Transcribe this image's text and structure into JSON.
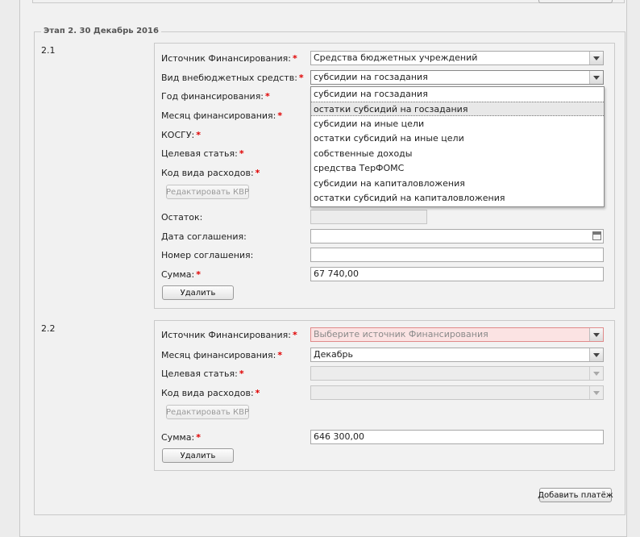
{
  "stage_title": "Этап 2. 30 Декабрь 2016",
  "group1": {
    "number": "2.1",
    "labels": {
      "source": "Источник Финансирования:",
      "extra_type": "Вид внебюджетных средств:",
      "year": "Год финансирования:",
      "month": "Месяц финансирования:",
      "kosgu": "КОСГУ:",
      "target": "Целевая статья:",
      "expense_code": "Код вида расходов:",
      "remainder": "Остаток:",
      "agreement_date": "Дата соглашения:",
      "agreement_number": "Номер соглашения:",
      "sum": "Сумма:"
    },
    "required_mark": "*",
    "source_value": "Средства бюджетных учреждений",
    "extra_type_value": "субсидии на госзадания",
    "remainder_value": "",
    "agreement_date_value": "",
    "agreement_number_value": "",
    "sum_value": "67 740,00",
    "edit_kvr_label": "Редактировать КВР",
    "delete_label": "Удалить",
    "dropdown_options": [
      "субсидии на госзадания",
      "остатки субсидий на госзадания",
      "субсидии на иные цели",
      "остатки субсидий на иные цели",
      "собственные доходы",
      "средства ТерФОМС",
      "субсидии на капиталовложения",
      "остатки субсидий на капиталовложения"
    ],
    "dropdown_highlighted": "остатки субсидий на госзадания"
  },
  "group2": {
    "number": "2.2",
    "labels": {
      "source": "Источник Финансирования:",
      "month": "Месяц финансирования:",
      "target": "Целевая статья:",
      "expense_code": "Код вида расходов:",
      "sum": "Сумма:"
    },
    "required_mark": "*",
    "source_placeholder": "Выберите источник Финансирования",
    "month_value": "Декабрь",
    "target_value": "",
    "expense_code_value": "",
    "sum_value": "646 300,00",
    "edit_kvr_label": "Редактировать КВР",
    "delete_label": "Удалить"
  },
  "add_payment_label": "Добавить платёж",
  "colors": {
    "required": "#e00000",
    "error_bg": "#fbe3e3",
    "error_border": "#e08a8a",
    "panel_bg": "#f1f1f1"
  }
}
